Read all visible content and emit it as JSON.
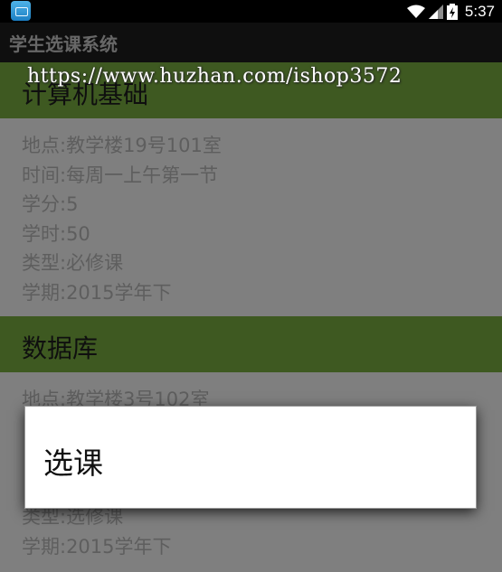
{
  "status_bar": {
    "time": "5:37",
    "icons": [
      "app-notification-icon",
      "wifi-icon",
      "cell-signal-icon",
      "battery-charging-icon"
    ]
  },
  "action_bar": {
    "title": "学生选课系统"
  },
  "watermark": "https://www.huzhan.com/ishop3572",
  "courses": [
    {
      "name": "计算机基础",
      "location": "地点:教学楼19号101室",
      "time": "时间:每周一上午第一节",
      "credit": "学分:5",
      "hours": "学时:50",
      "type": "类型:必修课",
      "term": "学期:2015学年下"
    },
    {
      "name": "数据库",
      "location": "地点:教学楼3号102室",
      "time": "",
      "credit": "",
      "hours": "",
      "type": "类型:选修课",
      "term": "学期:2015学年下"
    }
  ],
  "dialog": {
    "item_label": "选课"
  },
  "colors": {
    "header_green": "#7cb342",
    "status_bar": "#000000",
    "action_bar": "#1e1e1e"
  }
}
